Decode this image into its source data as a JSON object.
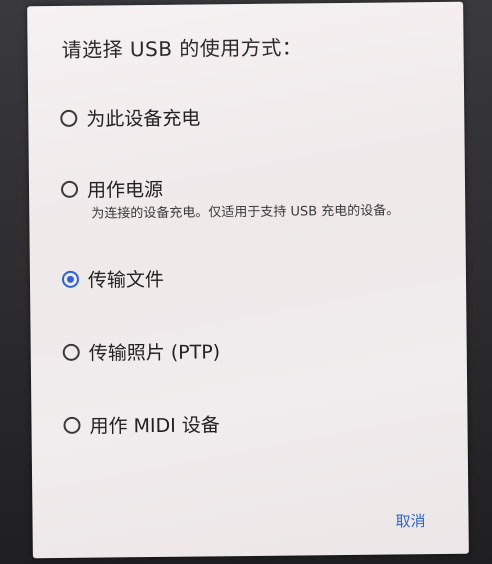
{
  "dialog": {
    "title": "请选择 USB 的使用方式：",
    "options": [
      {
        "label": "为此设备充电",
        "selected": false
      },
      {
        "label": "用作电源",
        "selected": false,
        "description": "为连接的设备充电。仅适用于支持 USB 充电的设备。"
      },
      {
        "label": "传输文件",
        "selected": true
      },
      {
        "label": "传输照片 (PTP)",
        "selected": false
      },
      {
        "label": "用作 MIDI 设备",
        "selected": false
      }
    ],
    "cancel_label": "取消"
  },
  "colors": {
    "accent": "#2c63d8",
    "dialog_background": "#f3eeef",
    "text": "#222222"
  }
}
